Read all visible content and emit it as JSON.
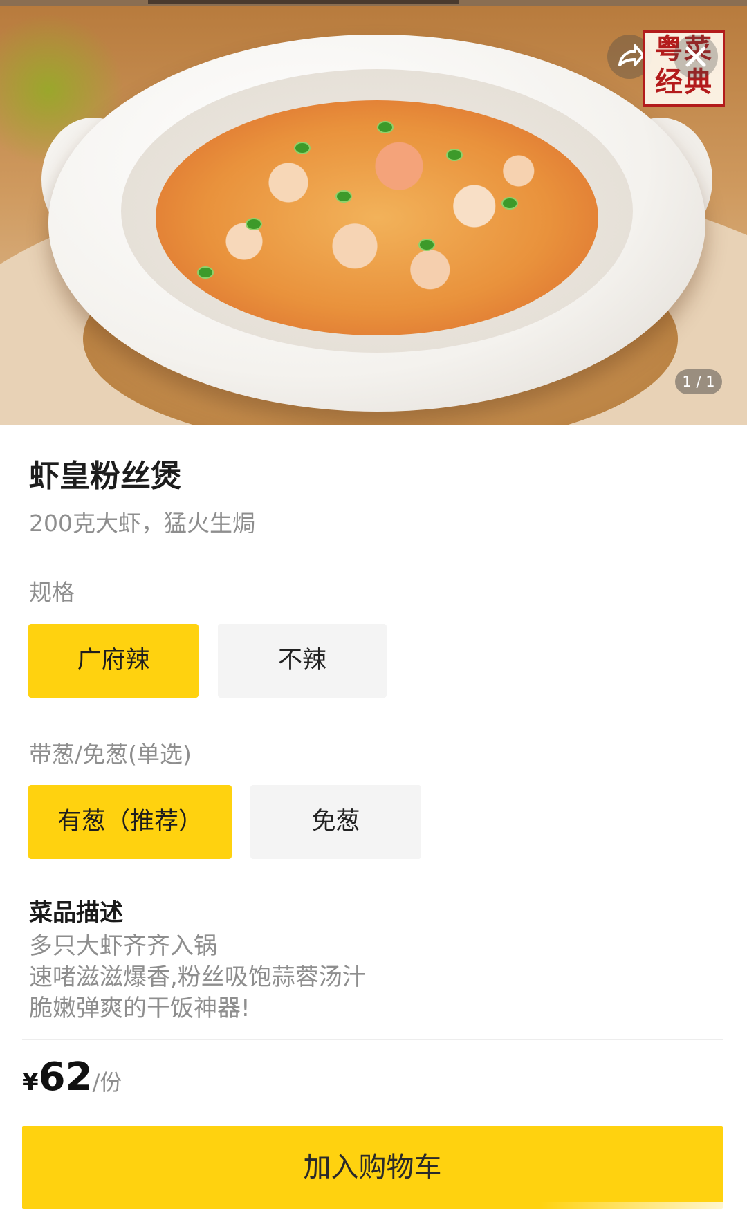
{
  "hero": {
    "pager": "1 / 1",
    "stamp_line1": "粤菜",
    "stamp_line2": "经典",
    "share_icon": "share-arrow-icon",
    "close_icon": "close-icon"
  },
  "dish": {
    "name": "虾皇粉丝煲",
    "tagline": "200克大虾，猛火生焗"
  },
  "spec": {
    "label": "规格",
    "options": [
      "广府辣",
      "不辣"
    ],
    "selected": "广府辣"
  },
  "scallion": {
    "label": "带葱/免葱(单选)",
    "options": [
      "有葱（推荐）",
      "免葱"
    ],
    "selected": "有葱（推荐）"
  },
  "description": {
    "title": "菜品描述",
    "lines": [
      "多只大虾齐齐入锅",
      "速啫滋滋爆香,粉丝吸饱蒜蓉汤汁",
      "脆嫩弹爽的干饭神器!"
    ]
  },
  "price": {
    "currency": "¥",
    "amount": "62",
    "unit": "/份"
  },
  "cart_button": "加入购物车",
  "colors": {
    "accent": "#ffd20f",
    "option_bg": "#f4f4f4",
    "muted_text": "#8e8e8e",
    "stamp_red": "#b31b1b"
  }
}
